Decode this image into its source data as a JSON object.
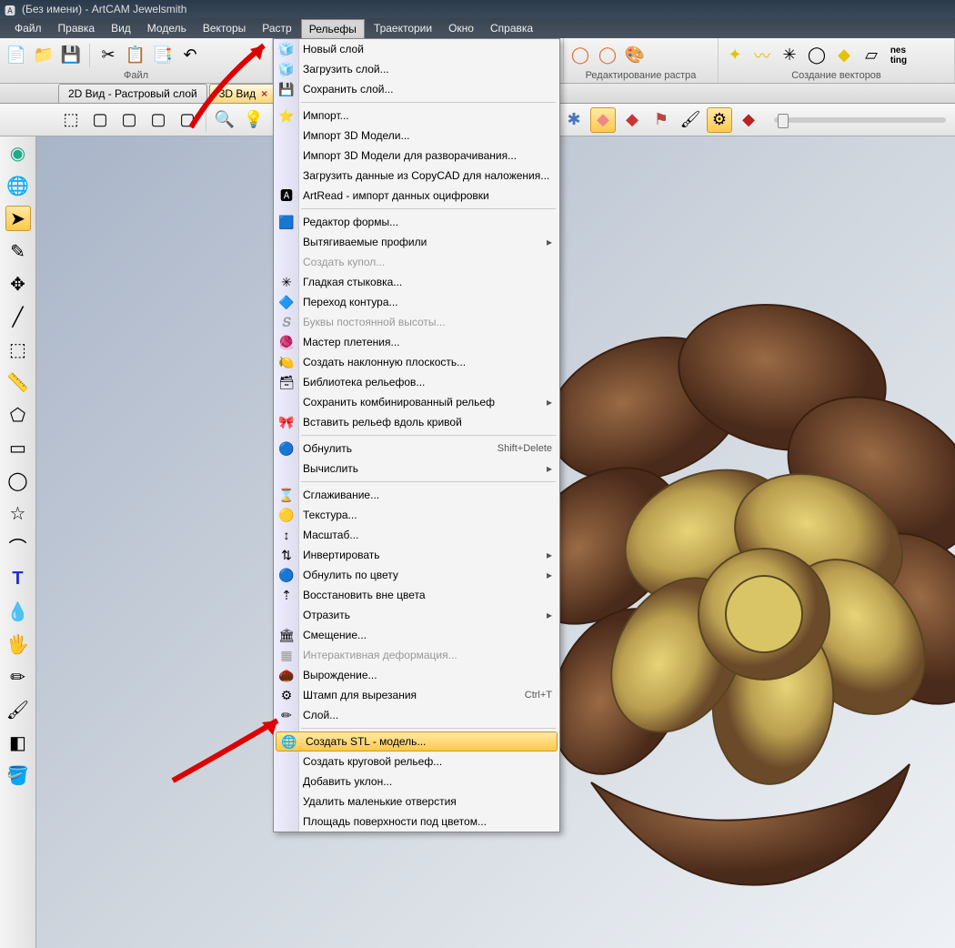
{
  "title": "(Без имени) - ArtCAM Jewelsmith",
  "menubar": [
    "Файл",
    "Правка",
    "Вид",
    "Модель",
    "Векторы",
    "Растр",
    "Рельефы",
    "Траектории",
    "Окно",
    "Справка"
  ],
  "toolbar_groups": {
    "file": "Файл",
    "raster": "Редактирование растра",
    "vectors": "Создание векторов"
  },
  "tabs": {
    "t2d": "2D Вид - Растровый слой",
    "t3d": "3D Вид"
  },
  "dropdown": {
    "items": [
      {
        "label": "Новый слой",
        "icon": "🧊"
      },
      {
        "label": "Загрузить слой...",
        "icon": "🧊"
      },
      {
        "label": "Сохранить слой...",
        "icon": "💾"
      },
      {
        "sep": true
      },
      {
        "label": "Импорт...",
        "icon": "⭐"
      },
      {
        "label": "Импорт 3D Модели...",
        "icon": ""
      },
      {
        "label": "Импорт 3D Модели для разворачивания...",
        "icon": ""
      },
      {
        "label": "Загрузить данные из CopyCAD для наложения...",
        "icon": ""
      },
      {
        "label": "ArtRead - импорт данных оцифровки",
        "icon": "🅰"
      },
      {
        "sep": true
      },
      {
        "label": "Редактор формы...",
        "icon": "🟦"
      },
      {
        "label": "Вытягиваемые профили",
        "icon": "",
        "sub": true
      },
      {
        "label": "Создать купол...",
        "icon": "",
        "disabled": true
      },
      {
        "label": "Гладкая стыковка...",
        "icon": "✳"
      },
      {
        "label": "Переход контура...",
        "icon": "🔷"
      },
      {
        "label": "Буквы постоянной высоты...",
        "icon": "𝑺",
        "disabled": true
      },
      {
        "label": "Мастер плетения...",
        "icon": "🧶"
      },
      {
        "label": "Создать наклонную плоскость...",
        "icon": "🍋"
      },
      {
        "label": "Библиотека рельефов...",
        "icon": "🗃"
      },
      {
        "label": "Сохранить комбинированный рельеф",
        "icon": "",
        "sub": true
      },
      {
        "label": "Вставить рельеф вдоль кривой",
        "icon": "🎀"
      },
      {
        "sep": true
      },
      {
        "label": "Обнулить",
        "icon": "🔵",
        "right": "Shift+Delete"
      },
      {
        "label": "Вычислить",
        "icon": "",
        "sub": true
      },
      {
        "sep": true
      },
      {
        "label": "Сглаживание...",
        "icon": "⌛"
      },
      {
        "label": "Текстура...",
        "icon": "🟡"
      },
      {
        "label": "Масштаб...",
        "icon": "↕"
      },
      {
        "label": "Инвертировать",
        "icon": "⇅",
        "sub": true
      },
      {
        "label": "Обнулить по цвету",
        "icon": "🔵",
        "sub": true
      },
      {
        "label": "Восстановить вне цвета",
        "icon": "⇡"
      },
      {
        "label": "Отразить",
        "icon": "",
        "sub": true
      },
      {
        "label": "Смещение...",
        "icon": "🏛"
      },
      {
        "label": "Интерактивная деформация...",
        "icon": "▦",
        "disabled": true
      },
      {
        "label": "Вырождение...",
        "icon": "🌰"
      },
      {
        "label": "Штамп для вырезания",
        "icon": "⚙",
        "right": "Ctrl+T"
      },
      {
        "label": "Слой...",
        "icon": "✏"
      },
      {
        "sep": true
      },
      {
        "label": "Создать STL - модель...",
        "icon": "🌐",
        "hl": true
      },
      {
        "label": "Создать круговой рельеф...",
        "icon": ""
      },
      {
        "label": "Добавить уклон...",
        "icon": ""
      },
      {
        "label": "Удалить маленькие отверстия",
        "icon": ""
      },
      {
        "label": "Площадь поверхности под цветом...",
        "icon": ""
      }
    ]
  }
}
